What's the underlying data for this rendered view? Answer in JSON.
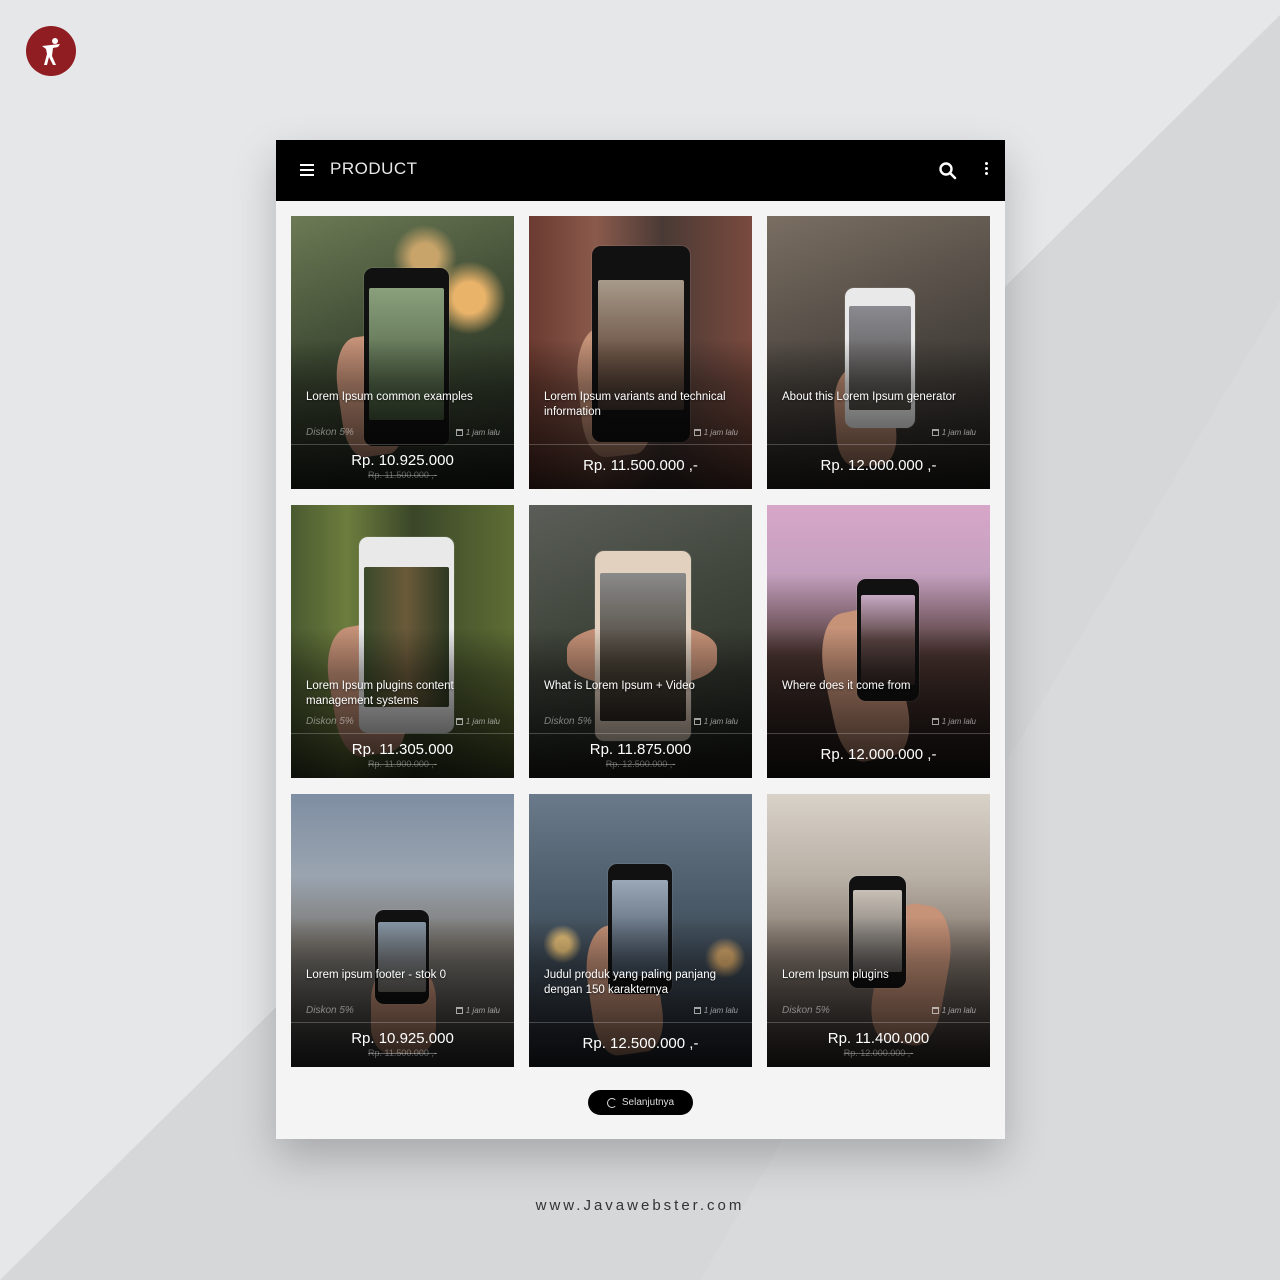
{
  "brand": {
    "logo_icon": "dancer-logo-icon",
    "color": "#8f1d22"
  },
  "appbar": {
    "title": "PRODUCT",
    "menu_icon": "hamburger-icon",
    "search_icon": "search-icon",
    "more_icon": "kebab-menu-icon"
  },
  "products": [
    {
      "title": "Lorem Ipsum common examples",
      "discount": "Diskon 5%",
      "time": "1 jam lalu",
      "price": "Rp. 10.925.000",
      "old_price": "Rp. 11.500.000 ,-"
    },
    {
      "title": "Lorem Ipsum variants and technical information",
      "discount": "",
      "time": "1 jam lalu",
      "price": "Rp. 11.500.000 ,-",
      "old_price": ""
    },
    {
      "title": "About this Lorem Ipsum generator",
      "discount": "",
      "time": "1 jam lalu",
      "price": "Rp. 12.000.000 ,-",
      "old_price": ""
    },
    {
      "title": "Lorem Ipsum plugins content management systems",
      "discount": "Diskon 5%",
      "time": "1 jam lalu",
      "price": "Rp. 11.305.000",
      "old_price": "Rp. 11.900.000 ,-"
    },
    {
      "title": "What is Lorem Ipsum + Video",
      "discount": "Diskon 5%",
      "time": "1 jam lalu",
      "price": "Rp. 11.875.000",
      "old_price": "Rp. 12.500.000 ,-"
    },
    {
      "title": "Where does it come from",
      "discount": "",
      "time": "1 jam lalu",
      "price": "Rp. 12.000.000 ,-",
      "old_price": ""
    },
    {
      "title": "Lorem ipsum footer - stok 0",
      "discount": "Diskon 5%",
      "time": "1 jam lalu",
      "price": "Rp. 10.925.000",
      "old_price": "Rp. 11.500.000 ,-"
    },
    {
      "title": "Judul produk yang paling panjang dengan 150 karakternya",
      "discount": "",
      "time": "1 jam lalu",
      "price": "Rp. 12.500.000 ,-",
      "old_price": ""
    },
    {
      "title": "Lorem Ipsum plugins",
      "discount": "Diskon 5%",
      "time": "1 jam lalu",
      "price": "Rp. 11.400.000",
      "old_price": "Rp. 12.000.000 ,-"
    }
  ],
  "pagination": {
    "next_label": "Selanjutnya",
    "icon": "refresh-icon"
  },
  "footer": {
    "url": "www.Javawebster.com"
  }
}
